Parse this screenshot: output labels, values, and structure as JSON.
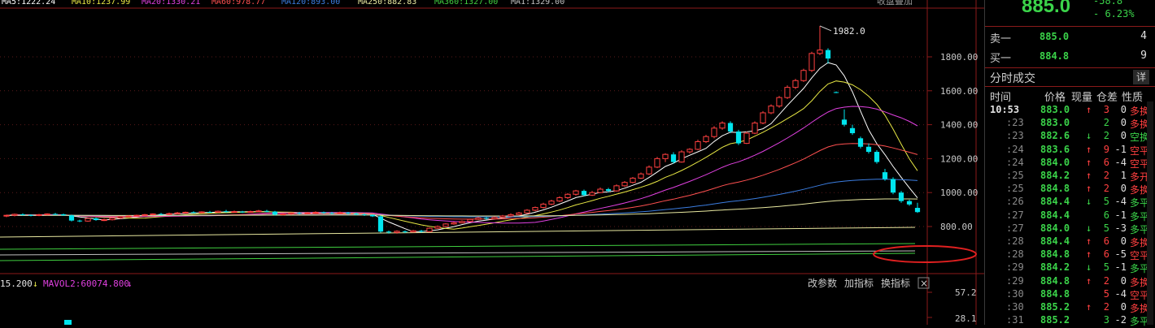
{
  "ma_legend": [
    "MA5:1222.24",
    "MA10:1237.99",
    "MA20:1330.21",
    "MA60:978.77",
    "MA120:893.00",
    "MA250:882.83",
    "MA360:1327.00",
    "MA1:1329.00"
  ],
  "ma_legend_right": "收盘叠加",
  "vol_legend": [
    {
      "text": "15.200",
      "color": "#e6e6e6"
    },
    {
      "text": "MAVOL2:60074.800",
      "color": "#e040e0"
    }
  ],
  "vol_arrows": [
    "↓",
    "↓"
  ],
  "buttons": {
    "params": "改参数",
    "add": "加指标",
    "switch": "换指标",
    "close": "×"
  },
  "quote": {
    "price": "885.0",
    "change": "-58.8",
    "change_pct": "- 6.23%"
  },
  "orderbook": [
    {
      "label": "卖一",
      "price": "885.0",
      "vol": "4"
    },
    {
      "label": "买一",
      "price": "884.8",
      "vol": "9"
    }
  ],
  "trades_title": "分时成交",
  "detail_button": "详",
  "trade_headers": [
    "时间",
    "价格",
    "现量",
    "仓差",
    "性质"
  ],
  "trades": [
    {
      "time": "10:53",
      "price": "883.0",
      "arrow": "↑",
      "vol": "3",
      "pos": "0",
      "nature": "多换"
    },
    {
      "time": ":23",
      "price": "883.0",
      "arrow": "",
      "vol": "2",
      "pos": "0",
      "nature": "多换"
    },
    {
      "time": ":23",
      "price": "882.6",
      "arrow": "↓",
      "vol": "2",
      "pos": "0",
      "nature": "空换"
    },
    {
      "time": ":24",
      "price": "883.6",
      "arrow": "↑",
      "vol": "9",
      "pos": "-1",
      "nature": "空平"
    },
    {
      "time": ":24",
      "price": "884.0",
      "arrow": "↑",
      "vol": "6",
      "pos": "-4",
      "nature": "空平"
    },
    {
      "time": ":25",
      "price": "884.2",
      "arrow": "↑",
      "vol": "2",
      "pos": "1",
      "nature": "多开"
    },
    {
      "time": ":25",
      "price": "884.8",
      "arrow": "↑",
      "vol": "2",
      "pos": "0",
      "nature": "多换"
    },
    {
      "time": ":26",
      "price": "884.4",
      "arrow": "↓",
      "vol": "5",
      "pos": "-4",
      "nature": "多平"
    },
    {
      "time": ":27",
      "price": "884.4",
      "arrow": "",
      "vol": "6",
      "pos": "-1",
      "nature": "多平"
    },
    {
      "time": ":27",
      "price": "884.0",
      "arrow": "↓",
      "vol": "5",
      "pos": "-3",
      "nature": "多平"
    },
    {
      "time": ":28",
      "price": "884.4",
      "arrow": "↑",
      "vol": "6",
      "pos": "0",
      "nature": "多换"
    },
    {
      "time": ":28",
      "price": "884.8",
      "arrow": "↑",
      "vol": "6",
      "pos": "-5",
      "nature": "空平"
    },
    {
      "time": ":29",
      "price": "884.2",
      "arrow": "↓",
      "vol": "5",
      "pos": "-1",
      "nature": "多平"
    },
    {
      "time": ":29",
      "price": "884.8",
      "arrow": "↑",
      "vol": "2",
      "pos": "0",
      "nature": "多换"
    },
    {
      "time": ":30",
      "price": "884.8",
      "arrow": "",
      "vol": "5",
      "pos": "-4",
      "nature": "空平"
    },
    {
      "time": ":30",
      "price": "885.2",
      "arrow": "↑",
      "vol": "2",
      "pos": "0",
      "nature": "多换"
    },
    {
      "time": ":31",
      "price": "885.2",
      "arrow": "",
      "vol": "3",
      "pos": "-2",
      "nature": "多平"
    }
  ],
  "colors": {
    "up": "#ff4040",
    "down": "#3bd44a",
    "candle_down": "#00e5ee",
    "candle_up": "#ff4040",
    "annotation": "#e02020"
  },
  "chart_data": {
    "type": "candlestick",
    "ylim": [
      650,
      2000
    ],
    "y_ticks": [
      "1800.00",
      "1600.00",
      "1400.00",
      "1200.00",
      "1000.00",
      "800.00"
    ],
    "y_tick_values": [
      1800,
      1600,
      1400,
      1200,
      1000,
      800
    ],
    "max_label": "1982.0",
    "vol_ticks": [
      "57.2",
      "28.1"
    ],
    "candles": [
      [
        862,
        866,
        870,
        855
      ],
      [
        866,
        872,
        876,
        860
      ],
      [
        872,
        868,
        878,
        864
      ],
      [
        868,
        865,
        872,
        860
      ],
      [
        865,
        870,
        874,
        861
      ],
      [
        870,
        874,
        878,
        866
      ],
      [
        874,
        872,
        880,
        868
      ],
      [
        872,
        866,
        876,
        862
      ],
      [
        866,
        835,
        870,
        830
      ],
      [
        835,
        832,
        840,
        826
      ],
      [
        832,
        848,
        852,
        828
      ],
      [
        848,
        838,
        852,
        834
      ],
      [
        838,
        840,
        846,
        832
      ],
      [
        840,
        850,
        854,
        836
      ],
      [
        850,
        858,
        862,
        846
      ],
      [
        858,
        862,
        866,
        854
      ],
      [
        862,
        866,
        870,
        858
      ],
      [
        866,
        870,
        874,
        862
      ],
      [
        870,
        874,
        878,
        866
      ],
      [
        874,
        872,
        880,
        868
      ],
      [
        872,
        876,
        882,
        868
      ],
      [
        876,
        880,
        886,
        872
      ],
      [
        880,
        884,
        888,
        876
      ],
      [
        884,
        882,
        890,
        878
      ],
      [
        882,
        886,
        890,
        878
      ],
      [
        886,
        884,
        892,
        880
      ],
      [
        884,
        890,
        894,
        880
      ],
      [
        890,
        886,
        898,
        882
      ],
      [
        886,
        888,
        894,
        882
      ],
      [
        888,
        885,
        892,
        880
      ],
      [
        885,
        888,
        894,
        882
      ],
      [
        888,
        892,
        898,
        884
      ],
      [
        892,
        888,
        898,
        884
      ],
      [
        888,
        870,
        892,
        864
      ],
      [
        870,
        874,
        880,
        866
      ],
      [
        874,
        880,
        884,
        868
      ],
      [
        880,
        876,
        886,
        870
      ],
      [
        876,
        880,
        886,
        872
      ],
      [
        880,
        884,
        890,
        876
      ],
      [
        884,
        880,
        888,
        874
      ],
      [
        880,
        878,
        886,
        872
      ],
      [
        878,
        882,
        888,
        874
      ],
      [
        882,
        876,
        886,
        870
      ],
      [
        876,
        872,
        882,
        866
      ],
      [
        872,
        868,
        878,
        862
      ],
      [
        868,
        860,
        872,
        856
      ],
      [
        860,
        770,
        866,
        764
      ],
      [
        770,
        765,
        776,
        758
      ],
      [
        765,
        772,
        778,
        758
      ],
      [
        772,
        768,
        776,
        762
      ],
      [
        768,
        775,
        780,
        764
      ],
      [
        775,
        770,
        780,
        764
      ],
      [
        770,
        790,
        794,
        766
      ],
      [
        790,
        800,
        806,
        786
      ],
      [
        800,
        815,
        820,
        796
      ],
      [
        815,
        822,
        828,
        810
      ],
      [
        822,
        830,
        836,
        818
      ],
      [
        830,
        842,
        846,
        826
      ],
      [
        842,
        850,
        856,
        838
      ],
      [
        850,
        846,
        856,
        840
      ],
      [
        846,
        854,
        860,
        842
      ],
      [
        854,
        862,
        868,
        850
      ],
      [
        862,
        870,
        878,
        856
      ],
      [
        870,
        880,
        886,
        866
      ],
      [
        880,
        896,
        902,
        874
      ],
      [
        896,
        912,
        918,
        890
      ],
      [
        912,
        932,
        940,
        906
      ],
      [
        932,
        950,
        958,
        926
      ],
      [
        950,
        970,
        978,
        944
      ],
      [
        970,
        990,
        996,
        962
      ],
      [
        990,
        1010,
        1016,
        982
      ],
      [
        1010,
        985,
        1018,
        978
      ],
      [
        985,
        1000,
        1010,
        980
      ],
      [
        1000,
        1020,
        1030,
        996
      ],
      [
        1020,
        1010,
        1028,
        1002
      ],
      [
        1010,
        1040,
        1048,
        1006
      ],
      [
        1040,
        1060,
        1068,
        1034
      ],
      [
        1060,
        1085,
        1092,
        1054
      ],
      [
        1085,
        1110,
        1118,
        1080
      ],
      [
        1110,
        1150,
        1160,
        1104
      ],
      [
        1150,
        1200,
        1210,
        1144
      ],
      [
        1200,
        1225,
        1232,
        1180
      ],
      [
        1225,
        1180,
        1238,
        1170
      ],
      [
        1180,
        1240,
        1250,
        1176
      ],
      [
        1240,
        1255,
        1262,
        1230
      ],
      [
        1255,
        1300,
        1312,
        1250
      ],
      [
        1300,
        1330,
        1340,
        1292
      ],
      [
        1330,
        1380,
        1392,
        1320
      ],
      [
        1380,
        1410,
        1420,
        1370
      ],
      [
        1410,
        1360,
        1420,
        1350
      ],
      [
        1360,
        1290,
        1370,
        1280
      ],
      [
        1290,
        1350,
        1360,
        1286
      ],
      [
        1350,
        1410,
        1420,
        1344
      ],
      [
        1410,
        1470,
        1480,
        1402
      ],
      [
        1470,
        1510,
        1520,
        1462
      ],
      [
        1510,
        1560,
        1570,
        1500
      ],
      [
        1560,
        1620,
        1632,
        1552
      ],
      [
        1620,
        1660,
        1670,
        1610
      ],
      [
        1660,
        1720,
        1730,
        1652
      ],
      [
        1720,
        1820,
        1830,
        1710
      ],
      [
        1820,
        1840,
        1982,
        1810
      ],
      [
        1840,
        1790,
        1850,
        1760
      ],
      [
        1592,
        1590,
        1596,
        1586
      ],
      [
        1430,
        1400,
        1490,
        1390
      ],
      [
        1380,
        1350,
        1400,
        1340
      ],
      [
        1320,
        1270,
        1330,
        1260
      ],
      [
        1270,
        1240,
        1290,
        1230
      ],
      [
        1240,
        1180,
        1250,
        1170
      ],
      [
        1120,
        1080,
        1140,
        1070
      ],
      [
        1080,
        1000,
        1090,
        990
      ],
      [
        1000,
        950,
        1010,
        940
      ],
      [
        950,
        930,
        958,
        922
      ],
      [
        910,
        885,
        940,
        880
      ]
    ],
    "ma_colors": [
      "#ffffff",
      "#e8e844",
      "#e040e0",
      "#ff5050",
      "#3b7de0",
      "#e8e8a0",
      "#40d040",
      "#c0c0c0"
    ]
  }
}
